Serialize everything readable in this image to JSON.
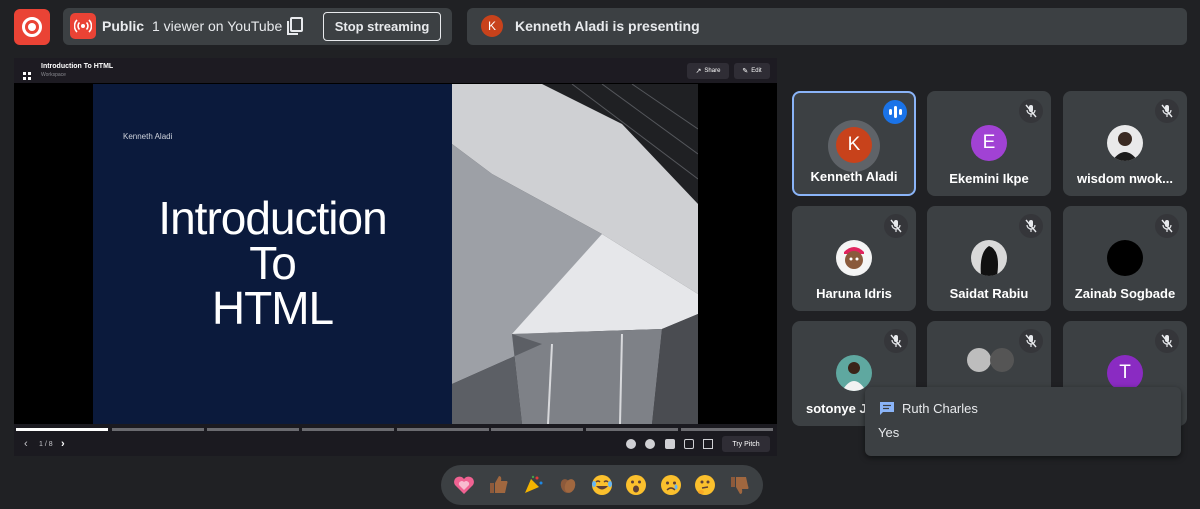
{
  "top_bar": {
    "visibility_label": "Public",
    "viewers_label": "1 viewer on YouTube",
    "stop_label": "Stop streaming",
    "presenting_initial": "K",
    "presenting_text": "Kenneth Aladi is presenting"
  },
  "presentation": {
    "doc_title": "Introduction To HTML",
    "doc_subtitle": "Workspace",
    "share_label": "Share",
    "edit_label": "Edit",
    "slide_author": "Kenneth Aladi",
    "slide_title_1": "Introduction",
    "slide_title_2": "To",
    "slide_title_3": "HTML",
    "page_indicator": "1 / 8",
    "try_pitch_label": "Try Pitch"
  },
  "participants": [
    {
      "name": "Kenneth Aladi",
      "initial": "K",
      "color": "#c8421b",
      "speaking": true
    },
    {
      "name": "Ekemini Ikpe",
      "initial": "E",
      "color": "#a142d4"
    },
    {
      "name": "wisdom nwok...",
      "initial": ""
    },
    {
      "name": "Haruna Idris",
      "initial": ""
    },
    {
      "name": "Saidat Rabiu",
      "initial": ""
    },
    {
      "name": "Zainab Sogbade",
      "initial": ""
    },
    {
      "name": "sotonye Jo",
      "initial": ""
    },
    {
      "name": "",
      "initial": ""
    },
    {
      "name": "",
      "initial": "T",
      "color": "#8a2bc2"
    }
  ],
  "chat": {
    "sender": "Ruth Charles",
    "message": "Yes"
  },
  "reactions": [
    "sparkling-heart",
    "thumbs-up",
    "party-popper",
    "clapping-hands",
    "tears-of-joy",
    "surprised-face",
    "crying-face",
    "thinking-face",
    "thumbs-down"
  ],
  "colors": {
    "accent_red": "#ea4335",
    "active_border": "#8ab4f8",
    "speaking_badge": "#1a73e8"
  }
}
